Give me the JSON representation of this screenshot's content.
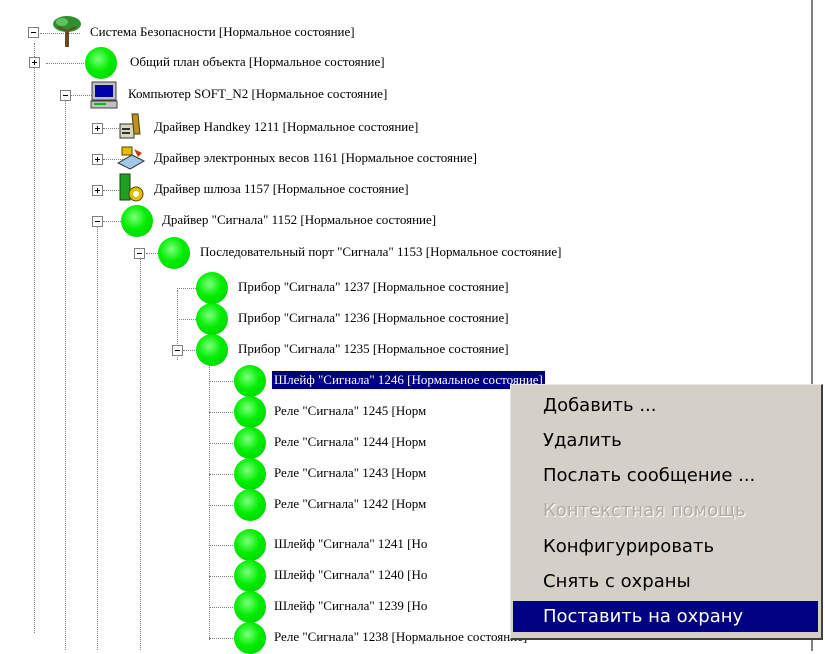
{
  "tree": {
    "nodes": [
      {
        "label": "Система Безопасности [Нормальное состояние]",
        "icon": "tree-icon",
        "toggle": "minus"
      },
      {
        "label": "Общий план объекта [Нормальное состояние]",
        "icon": "green-circle-icon",
        "toggle": "plus"
      },
      {
        "label": "Компьютер SOFT_N2 [Нормальное состояние]",
        "icon": "computer-icon",
        "toggle": "minus"
      },
      {
        "label": "Драйвер Handkey 1211 [Нормальное состояние]",
        "icon": "handkey-driver-icon",
        "toggle": "plus"
      },
      {
        "label": "Драйвер электронных весов 1161 [Нормальное состояние]",
        "icon": "scales-driver-icon",
        "toggle": "plus"
      },
      {
        "label": "Драйвер шлюза 1157 [Нормальное состояние]",
        "icon": "gateway-driver-icon",
        "toggle": "plus"
      },
      {
        "label": "Драйвер \"Сигнала\" 1152 [Нормальное состояние]",
        "icon": "green-circle-icon",
        "toggle": "minus"
      },
      {
        "label": "Последовательный порт \"Сигнала\" 1153 [Нормальное состояние]",
        "icon": "green-circle-icon",
        "toggle": "minus"
      },
      {
        "label": "Прибор \"Сигнала\" 1237 [Нормальное состояние]",
        "icon": "green-circle-icon",
        "toggle": "none"
      },
      {
        "label": "Прибор \"Сигнала\" 1236 [Нормальное состояние]",
        "icon": "green-circle-icon",
        "toggle": "none"
      },
      {
        "label": "Прибор \"Сигнала\" 1235 [Нормальное состояние]",
        "icon": "green-circle-icon",
        "toggle": "minus"
      },
      {
        "label": "Шлейф \"Сигнала\" 1246 [Нормальное состояние]",
        "icon": "green-circle-icon",
        "toggle": "none",
        "selected": true
      },
      {
        "label": "Реле \"Сигнала\" 1245 [Норм",
        "icon": "green-circle-icon",
        "toggle": "none"
      },
      {
        "label": "Реле \"Сигнала\" 1244 [Норм",
        "icon": "green-circle-icon",
        "toggle": "none"
      },
      {
        "label": "Реле \"Сигнала\" 1243 [Норм",
        "icon": "green-circle-icon",
        "toggle": "none"
      },
      {
        "label": "Реле \"Сигнала\" 1242 [Норм",
        "icon": "green-circle-icon",
        "toggle": "none"
      },
      {
        "label": "Шлейф \"Сигнала\" 1241 [Но",
        "icon": "green-circle-icon",
        "toggle": "none"
      },
      {
        "label": "Шлейф \"Сигнала\" 1240 [Но",
        "icon": "green-circle-icon",
        "toggle": "none"
      },
      {
        "label": "Шлейф \"Сигнала\" 1239 [Но",
        "icon": "green-circle-icon",
        "toggle": "none"
      },
      {
        "label": "Реле \"Сигнала\" 1238 [Нормальное состояние]",
        "icon": "green-circle-icon",
        "toggle": "none"
      }
    ]
  },
  "context_menu": {
    "items": [
      {
        "label": "Добавить ...",
        "enabled": true
      },
      {
        "label": "Удалить",
        "enabled": true
      },
      {
        "label": "Послать сообщение ...",
        "enabled": true
      },
      {
        "label": "Контекстная помощь",
        "enabled": false
      },
      {
        "label": "Конфигурировать",
        "enabled": true
      },
      {
        "label": "Снять с охраны",
        "enabled": true
      },
      {
        "label": "Поставить на охрану",
        "enabled": true,
        "highlighted": true
      }
    ]
  },
  "colors": {
    "selection": "#000080",
    "status_ok": "#00ff00",
    "menu_background": "#d4d0c8"
  }
}
